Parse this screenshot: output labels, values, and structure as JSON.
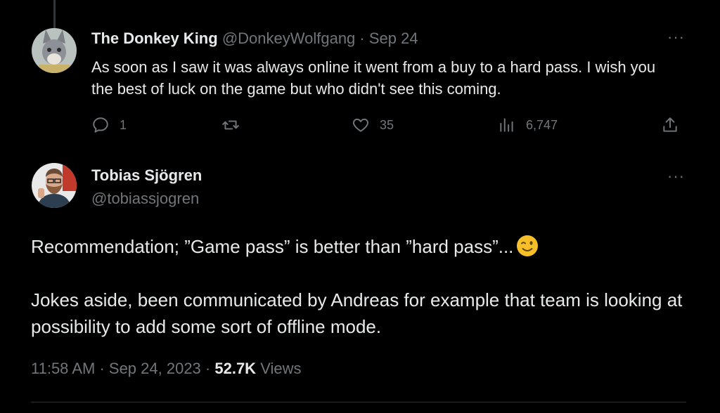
{
  "reply": {
    "author_name": "The Donkey King",
    "author_handle": "@DonkeyWolfgang",
    "separator": " · ",
    "date": "Sep 24",
    "text": "As soon as I saw it was always online it went from a buy to a hard pass. I wish you the best of luck on the game but who didn't see this coming.",
    "more_label": "···",
    "replies_count": "1",
    "likes_count": "35",
    "views_count": "6,747"
  },
  "main_tweet": {
    "author_name": "Tobias Sjögren",
    "author_handle": "@tobiassjogren",
    "more_label": "···",
    "paragraph_1": "Recommendation; ”Game pass” is better than ”hard pass”...",
    "paragraph_2": "Jokes aside, been communicated by Andreas for example that team is looking at possibility to add some sort of offline mode.",
    "time": "11:58 AM",
    "sep1": " · ",
    "date": "Sep 24, 2023",
    "sep2": " · ",
    "views_count": "52.7K",
    "views_label": " Views"
  },
  "icons": {
    "reply": "reply-icon",
    "retweet": "retweet-icon",
    "like": "heart-icon",
    "views": "analytics-icon",
    "share": "share-icon",
    "emoji": "winking-face-emoji"
  },
  "colors": {
    "background": "#000000",
    "text": "#e7e9ea",
    "muted": "#71767b",
    "emoji": "#f7c02b"
  }
}
